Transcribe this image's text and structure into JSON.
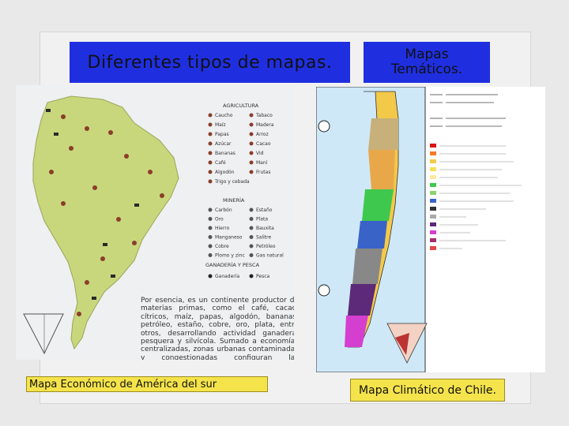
{
  "banner_left": "Diferentes tipos de mapas.",
  "banner_right": "Mapas\nTemáticos.",
  "caption_left": "Mapa Económico de América del sur",
  "caption_right": "Mapa Climático de Chile.",
  "economic_map": {
    "agricultura_title": "AGRICULTURA",
    "agricultura": [
      [
        "Caucho",
        "Tabaco"
      ],
      [
        "Maíz",
        "Madera"
      ],
      [
        "Papas",
        "Arroz"
      ],
      [
        "Azúcar",
        "Cacao"
      ],
      [
        "Bananas",
        "Vid"
      ],
      [
        "Café",
        "Maní"
      ],
      [
        "Algodón",
        "Frutas"
      ],
      [
        "Trigo y cebada",
        ""
      ]
    ],
    "mineria_title": "MINERÍA",
    "mineria": [
      [
        "Carbón",
        "Estaño"
      ],
      [
        "Oro",
        "Plata"
      ],
      [
        "Hierro",
        "Bauxita"
      ],
      [
        "Manganeso",
        "Salitre"
      ],
      [
        "Cobre",
        "Petróleo"
      ],
      [
        "Plomo y zinc",
        "Gas natural"
      ]
    ],
    "ganaderia_title": "GANADERÍA Y PESCA",
    "ganaderia": [
      "Ganadería",
      "Pesca"
    ],
    "paragraph": "Por esencia, es un continente productor de materias primas, como el café, cacao, cítricos, maíz, papas, algodón, bananas, petróleo, estaño, cobre, oro, plata, entre otros, desarrollando actividad ganadera, pesquera y silvícola. Sumado a economías centralizadas, zonas urbanas contaminadas y congestionadas configuran las características más importantes de este continente."
  },
  "colors": {
    "banner": "#1f2fe0",
    "caption": "#f4e34b",
    "land": "#c9d77c",
    "sea": "#eef0f2",
    "chile_sea": "#cfe8f7"
  }
}
